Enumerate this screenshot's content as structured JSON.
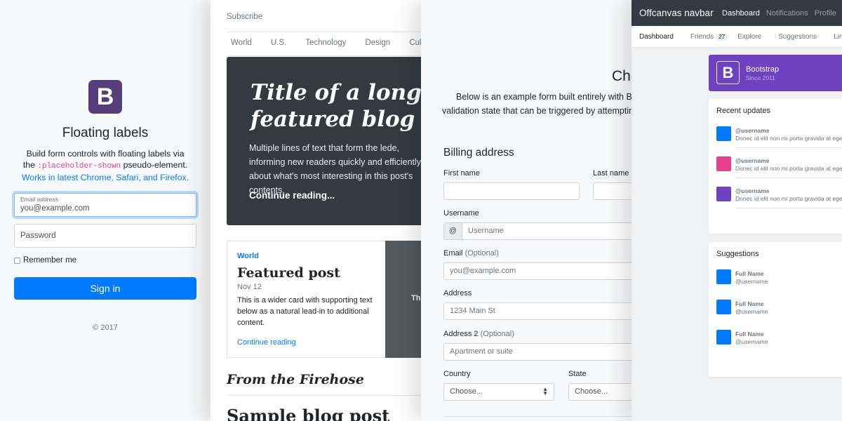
{
  "colors": {
    "primary": "#007bff",
    "bootstrap_purple": "#563d7c",
    "dark": "#343a40",
    "jumbotron": "#343a40",
    "offcanvas_banner": "#6f42c1",
    "avatar_blue": "#007bff",
    "avatar_pink": "#e83e8c",
    "avatar_purple": "#6f42c1"
  },
  "floating_labels": {
    "logo_letter": "B",
    "title": "Floating labels",
    "desc_prefix": "Build form controls with floating labels via the ",
    "desc_code": ":placeholder-shown",
    "desc_middle": " pseudo-element. ",
    "desc_link": "Works in latest Chrome, Safari, and Firefox.",
    "email_label": "Email address",
    "email_value": "you@example.com",
    "password_placeholder": "Password",
    "remember_label": "Remember me",
    "signin_label": "Sign in",
    "copyright": "© 2017"
  },
  "blog": {
    "subscribe": "Subscribe",
    "nav": [
      "World",
      "U.S.",
      "Technology",
      "Design",
      "Culture"
    ],
    "jumbo_title": "Title of a longer featured blog post",
    "jumbo_lede": "Multiple lines of text that form the lede, informing new readers quickly and efficiently about what's most interesting in this post's contents.",
    "jumbo_link": "Continue reading...",
    "card_category": "World",
    "card_title": "Featured post",
    "card_date": "Nov 12",
    "card_text": "This is a wider card with supporting text below as a natural lead-in to additional content.",
    "card_link": "Continue reading",
    "thumb_text": "Thumbnail",
    "firehose": "From the Firehose",
    "sample_title": "Sample blog post"
  },
  "checkout": {
    "title": "Checkout form",
    "lead_line1": "Below is an example form built entirely with Bootstrap's form controls.",
    "lead_line2": "validation state that can be triggered by attempting to submit the form.",
    "billing_heading": "Billing address",
    "first_name_label": "First name",
    "last_name_label": "Last name",
    "username_label": "Username",
    "username_prefix": "@",
    "username_placeholder": "Username",
    "email_label": "Email",
    "email_optional": "(Optional)",
    "email_placeholder": "you@example.com",
    "address_label": "Address",
    "address_placeholder": "1234 Main St",
    "address2_label": "Address 2",
    "address2_optional": "(Optional)",
    "address2_placeholder": "Apartment or suite",
    "country_label": "Country",
    "country_value": "Choose...",
    "state_label": "State",
    "state_value": "Choose..."
  },
  "offcanvas": {
    "brand": "Offcanvas navbar",
    "nav": [
      "Dashboard",
      "Notifications",
      "Profile"
    ],
    "subnav": [
      "Dashboard",
      "Friends",
      "Explore",
      "Suggestions",
      "Link"
    ],
    "friends_count": "27",
    "banner_letter": "B",
    "banner_title": "Bootstrap",
    "banner_sub": "Since 2011",
    "recent_heading": "Recent updates",
    "updates": [
      {
        "user": "@username",
        "text": "Donec id elit non mi porta gravida at eget metus.",
        "color": "#007bff"
      },
      {
        "user": "@username",
        "text": "Donec id elit non mi porta gravida at eget metus.",
        "color": "#e83e8c"
      },
      {
        "user": "@username",
        "text": "Donec id elit non mi porta gravida at eget metus.",
        "color": "#6f42c1"
      }
    ],
    "suggestions_heading": "Suggestions",
    "suggestions": [
      {
        "name": "Full Name",
        "user": "@username",
        "color": "#007bff"
      },
      {
        "name": "Full Name",
        "user": "@username",
        "color": "#007bff"
      },
      {
        "name": "Full Name",
        "user": "@username",
        "color": "#007bff"
      }
    ]
  }
}
